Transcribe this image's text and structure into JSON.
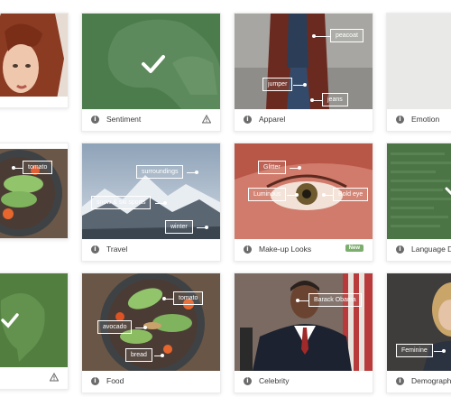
{
  "cards": [
    {
      "title": "Sentiment"
    },
    {
      "title": "Apparel"
    },
    {
      "title": "Emotion"
    },
    {
      "title": "Travel"
    },
    {
      "title": "Make-up Looks",
      "badge": "New"
    },
    {
      "title": "Language De"
    },
    {
      "title": "Food"
    },
    {
      "title": "Celebrity"
    },
    {
      "title": "Demographic"
    }
  ],
  "info_glyph": "i",
  "tags": {
    "apparel": [
      "peacoat",
      "jumper",
      "jeans"
    ],
    "food_top": [
      "tomato"
    ],
    "travel": [
      "surroundings",
      "snow & ski sports",
      "winter"
    ],
    "makeup": [
      "Glitter",
      "Luminous",
      "Bold eye"
    ],
    "food": [
      "tomato",
      "avocado",
      "bread"
    ],
    "celebrity": [
      "Barack Obama"
    ],
    "demographic": [
      "Feminine"
    ]
  },
  "colors": {
    "accent_green": "#4a7a49",
    "badge_green": "#7cae6e",
    "info_grey": "#6b6b6b"
  },
  "icons": [
    "info-icon",
    "warning-icon",
    "checkmark-icon"
  ]
}
